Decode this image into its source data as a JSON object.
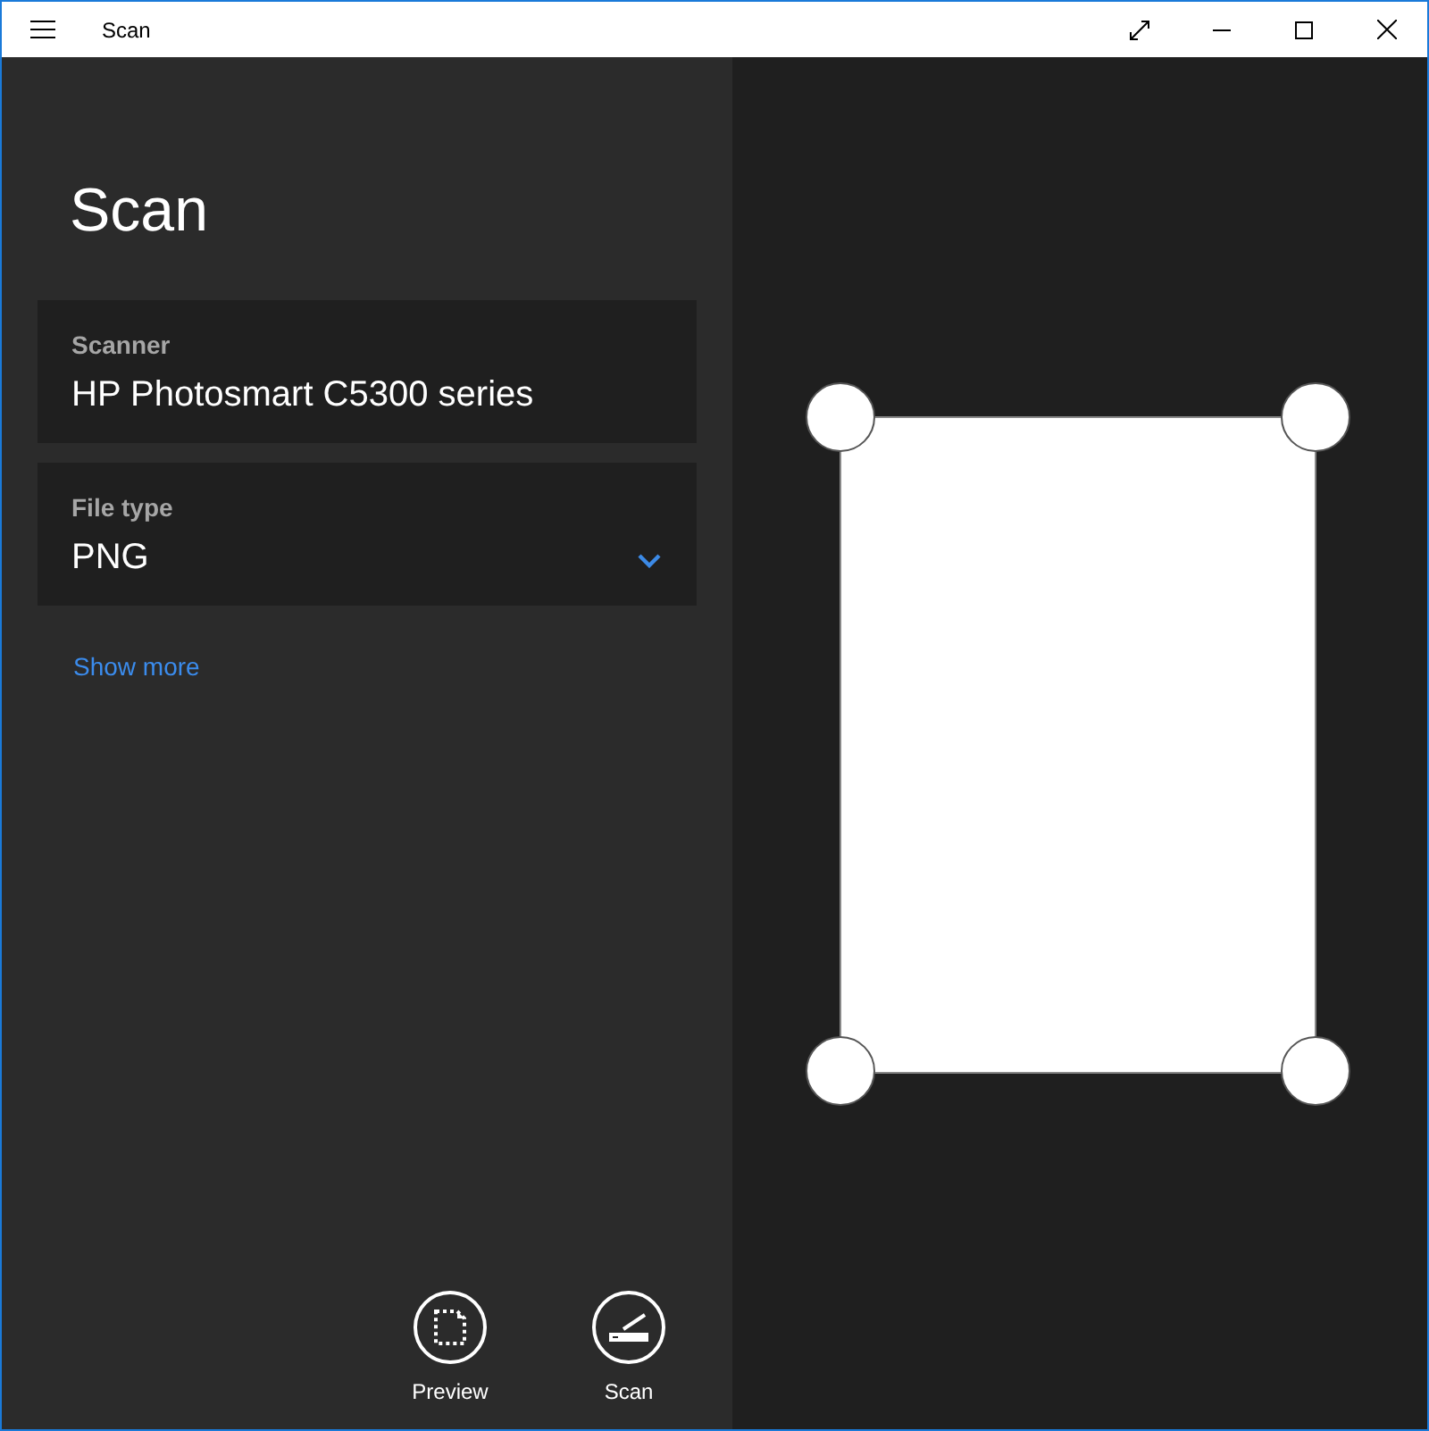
{
  "window": {
    "title": "Scan"
  },
  "heading": "Scan",
  "fields": [
    {
      "kind": "text",
      "label": "Scanner",
      "value": "HP Photosmart C5300 series"
    },
    {
      "kind": "dropdown",
      "label": "File type",
      "value": "PNG"
    }
  ],
  "link": "Show more",
  "actions": [
    {
      "kind": "preview",
      "label": "Preview"
    },
    {
      "kind": "scan",
      "label": "Scan"
    }
  ]
}
